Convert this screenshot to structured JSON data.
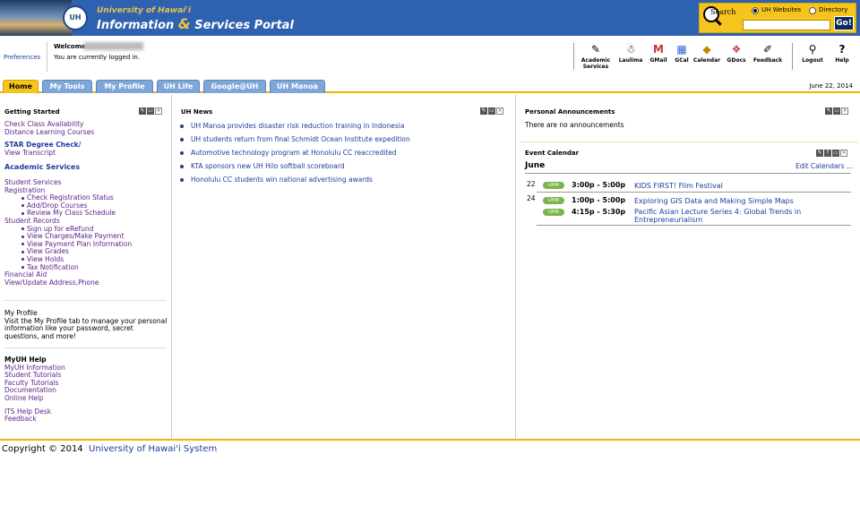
{
  "header": {
    "logo_univ": "University of Hawai'i",
    "logo_seal": "UH",
    "title_part1": "Information ",
    "title_amp": "&",
    "title_part2": " Services Portal"
  },
  "search": {
    "label": "Search",
    "options": [
      "UH Websites",
      "Directory"
    ],
    "selected": "UH Websites",
    "value": "",
    "placeholder": "",
    "go_label": "Go!"
  },
  "userbar": {
    "preferences": "Preferences",
    "welcome": "Welcome",
    "status": "You are currently logged in."
  },
  "quick_links": [
    {
      "label": "Academic",
      "label2": "Services",
      "icon": "✎"
    },
    {
      "label": "Laulima",
      "label2": "",
      "icon": "☃"
    },
    {
      "label": "GMail",
      "label2": "",
      "icon": "M"
    },
    {
      "label": "GCal",
      "label2": "",
      "icon": "▦"
    },
    {
      "label": "Calendar",
      "label2": "",
      "icon": "◆"
    },
    {
      "label": "GDocs",
      "label2": "",
      "icon": "❖"
    },
    {
      "label": "Feedback",
      "label2": "",
      "icon": "✐"
    },
    {
      "label": "Logout",
      "label2": "",
      "icon": "⚲"
    },
    {
      "label": "Help",
      "label2": "",
      "icon": "?"
    }
  ],
  "tabs": [
    "Home",
    "My Tools",
    "My Profile",
    "UH Life",
    "Google@UH",
    "UH Manoa"
  ],
  "date": "June 22, 2014",
  "getting_started": {
    "title": "Getting Started",
    "links1": [
      "Check Class Availability",
      "Distance Learning Courses"
    ],
    "star_head": "STAR Degree Check/",
    "star_sub": "View Transcript",
    "acad_head": "Academic Services",
    "student_services": "Student Services",
    "registration": "Registration",
    "reg_items": [
      "Check Registration Status",
      "Add/Drop Courses",
      "Review My Class Schedule"
    ],
    "student_records": "Student Records",
    "rec_items": [
      "Sign up for eRefund",
      "View Charges/Make Payment",
      "View Payment Plan Information",
      "View Grades",
      "View Holds",
      "Tax Notification"
    ],
    "financial_aid": "Financial Aid",
    "view_update": "View/Update Address,Phone",
    "profile_head": "My Profile",
    "profile_text": "Visit the My Profile tab to manage your personal information like your password, secret questions, and more!",
    "help_head": "MyUH Help",
    "help_items": [
      "MyUH Information",
      "Student Tutorials",
      "Faculty Tutorials",
      "Documentation",
      "Online Help"
    ],
    "help_items2": [
      "ITS Help Desk",
      "Feedback"
    ]
  },
  "news": {
    "title": "UH News",
    "items": [
      "UH Manoa provides disaster risk reduction training in Indonesia",
      "UH students return from final Schmidt Ocean Institute expedition",
      "Automotive technology program at Honolulu CC reaccredited",
      "KTA sponsors new UH Hilo softball scoreboard",
      "Honolulu CC students win national advertising awards"
    ]
  },
  "announcements": {
    "title": "Personal Announcements",
    "text": "There are no announcements"
  },
  "calendar": {
    "title": "Event Calendar",
    "month": "June",
    "edit": "Edit Calendars ...",
    "badge": "UHM",
    "events": [
      {
        "day": "22",
        "time": "3:00p - 5:00p",
        "title": "KIDS FIRST! Film Festival"
      },
      {
        "day": "24",
        "time": "1:00p - 5:00p",
        "title": "Exploring GIS Data and Making Simple Maps"
      },
      {
        "day": "",
        "time": "4:15p - 5:30p",
        "title": "Pacific Asian Lecture Series 4: Global Trends in Entrepreneurialism"
      }
    ]
  },
  "footer": {
    "copyright": "Copyright ©  2014",
    "org": "University of Hawai'i System"
  }
}
